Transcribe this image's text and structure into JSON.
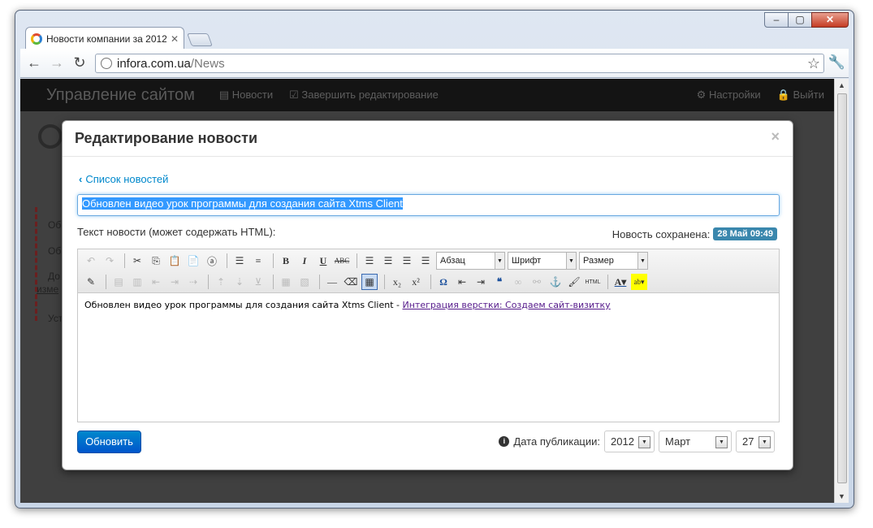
{
  "browser": {
    "tab_title": "Новости компании за 2012",
    "tab_close": "✕",
    "url_host": "infora.com.ua",
    "url_path": "/News"
  },
  "window_controls": {
    "minimize": "–",
    "maximize": "▢",
    "close": "✕"
  },
  "site_nav": {
    "brand": "Управление сайтом",
    "items": [
      "Новости",
      "Завершить редактирование"
    ],
    "right_items": [
      "Настройки",
      "Выйти"
    ]
  },
  "background_page": {
    "snippets": [
      "Об",
      "Об",
      "До",
      "изме",
      "Уст"
    ]
  },
  "modal": {
    "title": "Редактирование новости",
    "close": "×",
    "back_link": "Список новостей",
    "title_value": "Обновлен видео урок программы для создания сайта Xtms Client",
    "text_label": "Текст новости (может содержать HTML):",
    "saved_label": "Новость сохранена:",
    "saved_badge": "28 Май 09:49",
    "editor": {
      "format_select": "Абзац",
      "font_select": "Шрифт",
      "size_select": "Размер",
      "body_text": "Обновлен видео урок программы для создания сайта Xtms Client - ",
      "body_link": "Интеграция верстки: Создаем сайт-визитку"
    },
    "update_button": "Обновить",
    "pubdate_label": "Дата публикации:",
    "year": "2012",
    "month": "Март",
    "day": "27"
  },
  "colors": {
    "primary": "#0088cc",
    "badge": "#3a87ad",
    "navbar": "#141414"
  }
}
